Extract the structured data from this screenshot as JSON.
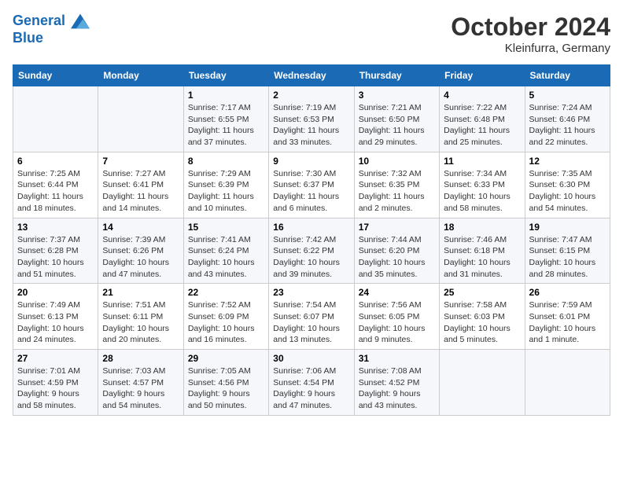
{
  "logo": {
    "line1": "General",
    "line2": "Blue"
  },
  "title": "October 2024",
  "location": "Kleinfurra, Germany",
  "days_header": [
    "Sunday",
    "Monday",
    "Tuesday",
    "Wednesday",
    "Thursday",
    "Friday",
    "Saturday"
  ],
  "weeks": [
    [
      {
        "day": "",
        "detail": ""
      },
      {
        "day": "",
        "detail": ""
      },
      {
        "day": "1",
        "detail": "Sunrise: 7:17 AM\nSunset: 6:55 PM\nDaylight: 11 hours and 37 minutes."
      },
      {
        "day": "2",
        "detail": "Sunrise: 7:19 AM\nSunset: 6:53 PM\nDaylight: 11 hours and 33 minutes."
      },
      {
        "day": "3",
        "detail": "Sunrise: 7:21 AM\nSunset: 6:50 PM\nDaylight: 11 hours and 29 minutes."
      },
      {
        "day": "4",
        "detail": "Sunrise: 7:22 AM\nSunset: 6:48 PM\nDaylight: 11 hours and 25 minutes."
      },
      {
        "day": "5",
        "detail": "Sunrise: 7:24 AM\nSunset: 6:46 PM\nDaylight: 11 hours and 22 minutes."
      }
    ],
    [
      {
        "day": "6",
        "detail": "Sunrise: 7:25 AM\nSunset: 6:44 PM\nDaylight: 11 hours and 18 minutes."
      },
      {
        "day": "7",
        "detail": "Sunrise: 7:27 AM\nSunset: 6:41 PM\nDaylight: 11 hours and 14 minutes."
      },
      {
        "day": "8",
        "detail": "Sunrise: 7:29 AM\nSunset: 6:39 PM\nDaylight: 11 hours and 10 minutes."
      },
      {
        "day": "9",
        "detail": "Sunrise: 7:30 AM\nSunset: 6:37 PM\nDaylight: 11 hours and 6 minutes."
      },
      {
        "day": "10",
        "detail": "Sunrise: 7:32 AM\nSunset: 6:35 PM\nDaylight: 11 hours and 2 minutes."
      },
      {
        "day": "11",
        "detail": "Sunrise: 7:34 AM\nSunset: 6:33 PM\nDaylight: 10 hours and 58 minutes."
      },
      {
        "day": "12",
        "detail": "Sunrise: 7:35 AM\nSunset: 6:30 PM\nDaylight: 10 hours and 54 minutes."
      }
    ],
    [
      {
        "day": "13",
        "detail": "Sunrise: 7:37 AM\nSunset: 6:28 PM\nDaylight: 10 hours and 51 minutes."
      },
      {
        "day": "14",
        "detail": "Sunrise: 7:39 AM\nSunset: 6:26 PM\nDaylight: 10 hours and 47 minutes."
      },
      {
        "day": "15",
        "detail": "Sunrise: 7:41 AM\nSunset: 6:24 PM\nDaylight: 10 hours and 43 minutes."
      },
      {
        "day": "16",
        "detail": "Sunrise: 7:42 AM\nSunset: 6:22 PM\nDaylight: 10 hours and 39 minutes."
      },
      {
        "day": "17",
        "detail": "Sunrise: 7:44 AM\nSunset: 6:20 PM\nDaylight: 10 hours and 35 minutes."
      },
      {
        "day": "18",
        "detail": "Sunrise: 7:46 AM\nSunset: 6:18 PM\nDaylight: 10 hours and 31 minutes."
      },
      {
        "day": "19",
        "detail": "Sunrise: 7:47 AM\nSunset: 6:15 PM\nDaylight: 10 hours and 28 minutes."
      }
    ],
    [
      {
        "day": "20",
        "detail": "Sunrise: 7:49 AM\nSunset: 6:13 PM\nDaylight: 10 hours and 24 minutes."
      },
      {
        "day": "21",
        "detail": "Sunrise: 7:51 AM\nSunset: 6:11 PM\nDaylight: 10 hours and 20 minutes."
      },
      {
        "day": "22",
        "detail": "Sunrise: 7:52 AM\nSunset: 6:09 PM\nDaylight: 10 hours and 16 minutes."
      },
      {
        "day": "23",
        "detail": "Sunrise: 7:54 AM\nSunset: 6:07 PM\nDaylight: 10 hours and 13 minutes."
      },
      {
        "day": "24",
        "detail": "Sunrise: 7:56 AM\nSunset: 6:05 PM\nDaylight: 10 hours and 9 minutes."
      },
      {
        "day": "25",
        "detail": "Sunrise: 7:58 AM\nSunset: 6:03 PM\nDaylight: 10 hours and 5 minutes."
      },
      {
        "day": "26",
        "detail": "Sunrise: 7:59 AM\nSunset: 6:01 PM\nDaylight: 10 hours and 1 minute."
      }
    ],
    [
      {
        "day": "27",
        "detail": "Sunrise: 7:01 AM\nSunset: 4:59 PM\nDaylight: 9 hours and 58 minutes."
      },
      {
        "day": "28",
        "detail": "Sunrise: 7:03 AM\nSunset: 4:57 PM\nDaylight: 9 hours and 54 minutes."
      },
      {
        "day": "29",
        "detail": "Sunrise: 7:05 AM\nSunset: 4:56 PM\nDaylight: 9 hours and 50 minutes."
      },
      {
        "day": "30",
        "detail": "Sunrise: 7:06 AM\nSunset: 4:54 PM\nDaylight: 9 hours and 47 minutes."
      },
      {
        "day": "31",
        "detail": "Sunrise: 7:08 AM\nSunset: 4:52 PM\nDaylight: 9 hours and 43 minutes."
      },
      {
        "day": "",
        "detail": ""
      },
      {
        "day": "",
        "detail": ""
      }
    ]
  ]
}
